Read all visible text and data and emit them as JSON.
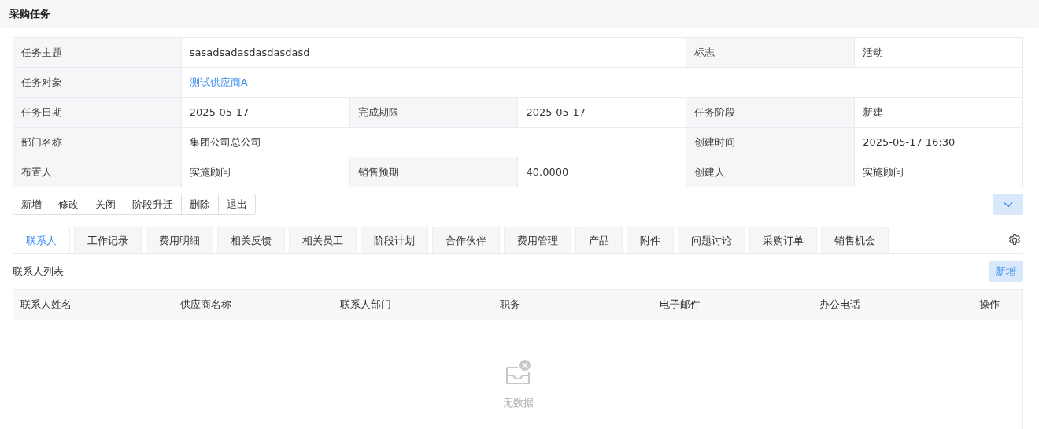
{
  "page_title": "采购任务",
  "detail_rows": [
    {
      "fields": [
        {
          "label": "任务主题",
          "value": "sasadsadasdasdasdasd",
          "kind": "text"
        },
        {
          "label": "标志",
          "value": "活动",
          "kind": "text"
        }
      ]
    },
    {
      "fields": [
        {
          "label": "任务对象",
          "value": "测试供应商A",
          "kind": "link"
        }
      ]
    },
    {
      "fields": [
        {
          "label": "任务日期",
          "value": "2025-05-17",
          "kind": "text"
        },
        {
          "label": "完成期限",
          "value": "2025-05-17",
          "kind": "text"
        },
        {
          "label": "任务阶段",
          "value": "新建",
          "kind": "text"
        }
      ]
    },
    {
      "fields": [
        {
          "label": "部门名称",
          "value": "集团公司总公司",
          "kind": "text"
        },
        {
          "label": "创建时间",
          "value": "2025-05-17 16:30",
          "kind": "text"
        }
      ]
    },
    {
      "fields": [
        {
          "label": "布置人",
          "value": "实施顾问",
          "kind": "text"
        },
        {
          "label": "销售预期",
          "value": "40.0000",
          "kind": "text"
        },
        {
          "label": "创建人",
          "value": "实施顾问",
          "kind": "text"
        }
      ]
    }
  ],
  "actions": [
    "新增",
    "修改",
    "关闭",
    "阶段升迁",
    "删除",
    "退出"
  ],
  "tabs": [
    {
      "label": "联系人",
      "selected": true
    },
    {
      "label": "工作记录",
      "selected": false
    },
    {
      "label": "费用明细",
      "selected": false
    },
    {
      "label": "相关反馈",
      "selected": false
    },
    {
      "label": "相关员工",
      "selected": false
    },
    {
      "label": "阶段计划",
      "selected": false
    },
    {
      "label": "合作伙伴",
      "selected": false
    },
    {
      "label": "费用管理",
      "selected": false
    },
    {
      "label": "产品",
      "selected": false
    },
    {
      "label": "附件",
      "selected": false
    },
    {
      "label": "问题讨论",
      "selected": false
    },
    {
      "label": "采购订单",
      "selected": false
    },
    {
      "label": "销售机会",
      "selected": false
    }
  ],
  "list": {
    "title": "联系人列表",
    "add_button": "新增",
    "columns": [
      "联系人姓名",
      "供应商名称",
      "联系人部门",
      "职务",
      "电子邮件",
      "办公电话",
      "操作"
    ],
    "empty_text": "无数据"
  }
}
